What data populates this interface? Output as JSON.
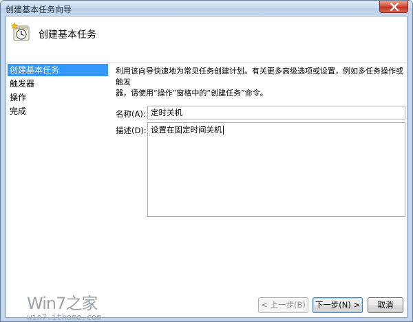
{
  "window": {
    "title": "创建基本任务向导"
  },
  "header": {
    "title": "创建基本任务",
    "icon": "task-scheduler-clock-icon"
  },
  "sidebar": {
    "items": [
      {
        "label": "创建基本任务",
        "active": true
      },
      {
        "label": "触发器",
        "active": false
      },
      {
        "label": "操作",
        "active": false
      },
      {
        "label": "完成",
        "active": false
      }
    ]
  },
  "main": {
    "intro_line1": "利用该向导快速地为常见任务创建计划。有关更多高级选项或设置，例如多任务操作或触发",
    "intro_line2": "器，请使用“操作”窗格中的“创建任务”命令。",
    "name_label": "名称(A):",
    "name_value": "定时关机",
    "desc_label": "描述(D):",
    "desc_value": "设置在固定时间关机"
  },
  "watermark": {
    "logo": "Win7之家",
    "url": "win7.ithome.com"
  },
  "buttons": {
    "back": "< 上一步(B)",
    "next": "下一步(N) >",
    "cancel": "取消"
  },
  "colors": {
    "selection": "#3399ff",
    "frame": "#bfd6ee",
    "close": "#c0321f"
  }
}
